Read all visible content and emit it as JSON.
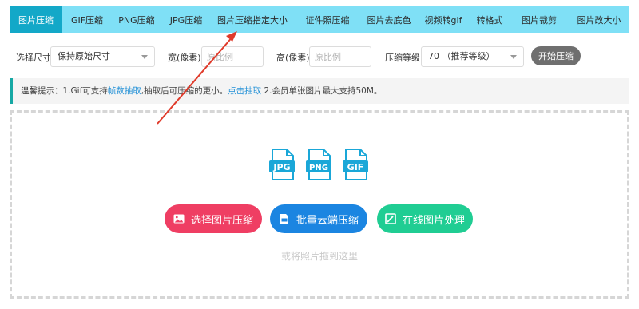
{
  "tabs": [
    {
      "label": "图片压缩",
      "active": true
    },
    {
      "label": "GIF压缩",
      "active": false
    },
    {
      "label": "PNG压缩",
      "active": false
    },
    {
      "label": "JPG压缩",
      "active": false
    },
    {
      "label": "图片压缩指定大小",
      "active": false
    },
    {
      "label": "证件照压缩",
      "active": false
    },
    {
      "label": "图片去底色",
      "active": false
    },
    {
      "label": "视频转gif",
      "active": false
    },
    {
      "label": "转格式",
      "active": false
    },
    {
      "label": "图片裁剪",
      "active": false
    },
    {
      "label": "图片改大小",
      "active": false
    }
  ],
  "options": {
    "size_label": "选择尺寸",
    "size_value": "保持原始尺寸",
    "width_label": "宽(像素)",
    "width_placeholder": "原比例",
    "height_label": "高(像素)",
    "height_placeholder": "原比例",
    "level_label": "压缩等级",
    "level_value": "70 （推荐等级）",
    "start_label": "开始压缩"
  },
  "notice": {
    "prefix": "温馨提示：1.Gif可支持",
    "link1": "帧数抽取",
    "middle": ",抽取后可压缩的更小。",
    "link2": "点击抽取",
    "suffix": " 2.会员单张图片最大支持50M。"
  },
  "formats": [
    "JPG",
    "PNG",
    "GIF"
  ],
  "buttons": {
    "select": "选择图片压缩",
    "batch": "批量云端压缩",
    "online": "在线图片处理"
  },
  "drop_hint": "或将照片拖到这里",
  "colors": {
    "tabbar": "#7fe0f6",
    "tab_active": "#13a8c8",
    "btn_red": "#ef3e63",
    "btn_blue": "#1b85e1",
    "btn_green": "#20cd93",
    "file_icon": "#1aa7d8",
    "annotation_arrow": "#e03a2a"
  },
  "icons": {
    "select": "image-icon",
    "batch": "cloud-file-icon",
    "online": "edit-image-icon"
  }
}
